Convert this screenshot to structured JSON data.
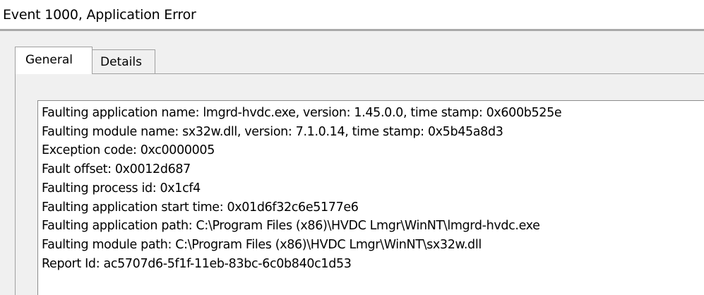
{
  "window": {
    "title": "Event 1000, Application Error"
  },
  "tabs": [
    {
      "label": "General",
      "selected": true
    },
    {
      "label": "Details",
      "selected": false
    }
  ],
  "event_message": {
    "lines": [
      "Faulting application name: lmgrd-hvdc.exe, version: 1.45.0.0, time stamp: 0x600b525e",
      "Faulting module name: sx32w.dll, version: 7.1.0.14, time stamp: 0x5b45a8d3",
      "Exception code: 0xc0000005",
      "Fault offset: 0x0012d687",
      "Faulting process id: 0x1cf4",
      "Faulting application start time: 0x01d6f32c6e5177e6",
      "Faulting application path: C:\\Program Files (x86)\\HVDC Lmgr\\WinNT\\lmgrd-hvdc.exe",
      "Faulting module path: C:\\Program Files (x86)\\HVDC Lmgr\\WinNT\\sx32w.dll",
      "Report Id: ac5707d6-5f1f-11eb-83bc-6c0b840c1d53"
    ]
  }
}
